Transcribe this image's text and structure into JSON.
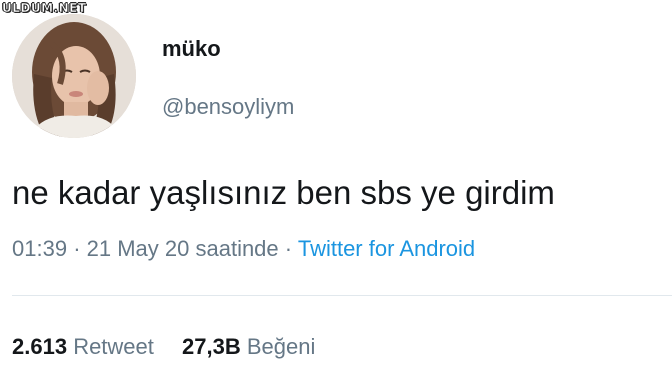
{
  "watermark": "ULDUM.NET",
  "tweet": {
    "display_name": "müko",
    "handle": "@bensoyliym",
    "text": "ne kadar yaşlısınız ben sbs ye girdim",
    "time": "01:39",
    "separator": "·",
    "date": "21 May 20 saatinde",
    "source": "Twitter for Android"
  },
  "stats": {
    "retweets_count": "2.613",
    "retweets_label": "Retweet",
    "likes_count": "27,3B",
    "likes_label": "Beğeni"
  },
  "colors": {
    "text": "#14171a",
    "secondary": "#657786",
    "link": "#1b95e0",
    "divider": "#e1e8ed"
  }
}
